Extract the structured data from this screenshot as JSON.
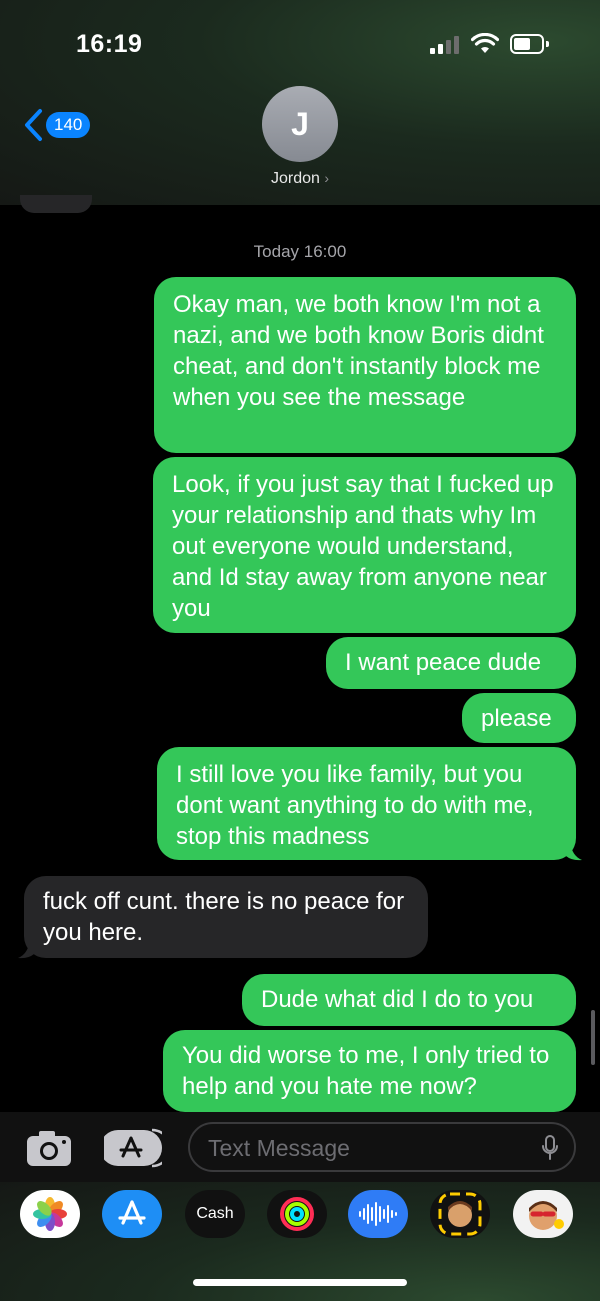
{
  "status": {
    "time": "16:19"
  },
  "nav": {
    "back_count": "140",
    "contact_initial": "J",
    "contact_name": "Jordon",
    "chevron": "›"
  },
  "thread": {
    "timestamp": "Today 16:00",
    "messages": [
      {
        "from": "me",
        "text": "Okay man, we both know I'm not a nazi, and we both know Boris didnt cheat, and don't instantly block me when you see the message"
      },
      {
        "from": "me",
        "text": "Look, if you just say that I fucked up your relationship and thats why Im out everyone would understand, and Id stay away from anyone near you"
      },
      {
        "from": "me",
        "text": "I want peace dude"
      },
      {
        "from": "me",
        "text": "please"
      },
      {
        "from": "me",
        "text": "I still love you like family, but you dont want anything to do with me, stop this madness"
      },
      {
        "from": "them",
        "text": "fuck off cunt. there is no peace for you here."
      },
      {
        "from": "me",
        "text": "Dude what did I do to you"
      },
      {
        "from": "me",
        "text": "You did worse to me, I only tried to help and you hate me now?"
      }
    ]
  },
  "composer": {
    "placeholder": "Text Message"
  },
  "apps": [
    {
      "name": "photos-app-icon"
    },
    {
      "name": "app-store-app-icon"
    },
    {
      "name": "apple-cash-app-icon",
      "label": "Cash"
    },
    {
      "name": "activity-app-icon"
    },
    {
      "name": "audio-message-app-icon"
    },
    {
      "name": "memoji-app-icon"
    },
    {
      "name": "memoji-stickers-app-icon"
    }
  ],
  "colors": {
    "sent_bubble": "#34c759",
    "recv_bubble": "#262628",
    "accent": "#0a84ff"
  }
}
